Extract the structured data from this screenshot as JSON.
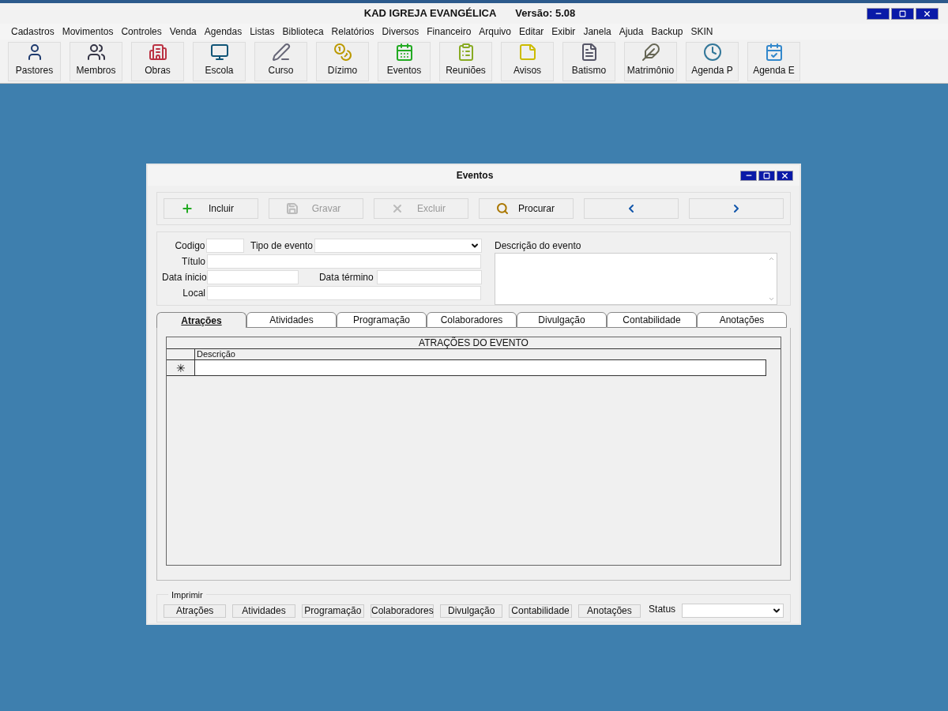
{
  "window": {
    "title": "KAD IGREJA EVANGÉLICA",
    "version": "Versão: 5.08"
  },
  "menu": [
    "Cadastros",
    "Movimentos",
    "Controles",
    "Venda",
    "Agendas",
    "Listas",
    "Biblioteca",
    "Relatórios",
    "Diversos",
    "Financeiro",
    "Arquivo",
    "Editar",
    "Exibir",
    "Janela",
    "Ajuda",
    "Backup",
    "SKIN"
  ],
  "toolbar": [
    "Pastores",
    "Membros",
    "Obras",
    "Escola",
    "Curso",
    "Dízimo",
    "Eventos",
    "Reuniões",
    "Avisos",
    "Batismo",
    "Matrimônio",
    "Agenda P",
    "Agenda E"
  ],
  "dialog": {
    "title": "Eventos",
    "actions": [
      {
        "kind": "add",
        "label": "Incluir",
        "disabled": false
      },
      {
        "kind": "save",
        "label": "Gravar",
        "disabled": true
      },
      {
        "kind": "delete",
        "label": "Excluir",
        "disabled": true
      },
      {
        "kind": "search",
        "label": "Procurar",
        "disabled": false
      },
      {
        "kind": "prev",
        "disabled": false
      },
      {
        "kind": "next",
        "disabled": false
      }
    ],
    "fields": {
      "codigo": "Codigo",
      "tipo": "Tipo de evento",
      "titulo": "Título",
      "inicio": "Data ínicio",
      "termino": "Data término",
      "local": "Local",
      "descricao": "Descrição do evento"
    },
    "tabs": [
      {
        "label": "Atrações",
        "selected": true
      },
      {
        "label": "Atividades",
        "selected": false
      },
      {
        "label": "Programação",
        "selected": false
      },
      {
        "label": "Colaboradores",
        "selected": false
      },
      {
        "label": "Divulgação",
        "selected": false
      },
      {
        "label": "Contabilidade",
        "selected": false
      },
      {
        "label": "Anotações",
        "selected": false
      }
    ],
    "grid": {
      "title": "ATRAÇÕES DO EVENTO",
      "columns": [
        "Descrição"
      ],
      "new_row_marker": "✳"
    },
    "print": {
      "label": "Imprimir",
      "buttons": [
        "Atrações",
        "Atividades",
        "Programação",
        "Colaboradores",
        "Divulgação",
        "Contabilidade",
        "Anotações"
      ]
    },
    "status": {
      "label": "Status"
    }
  }
}
